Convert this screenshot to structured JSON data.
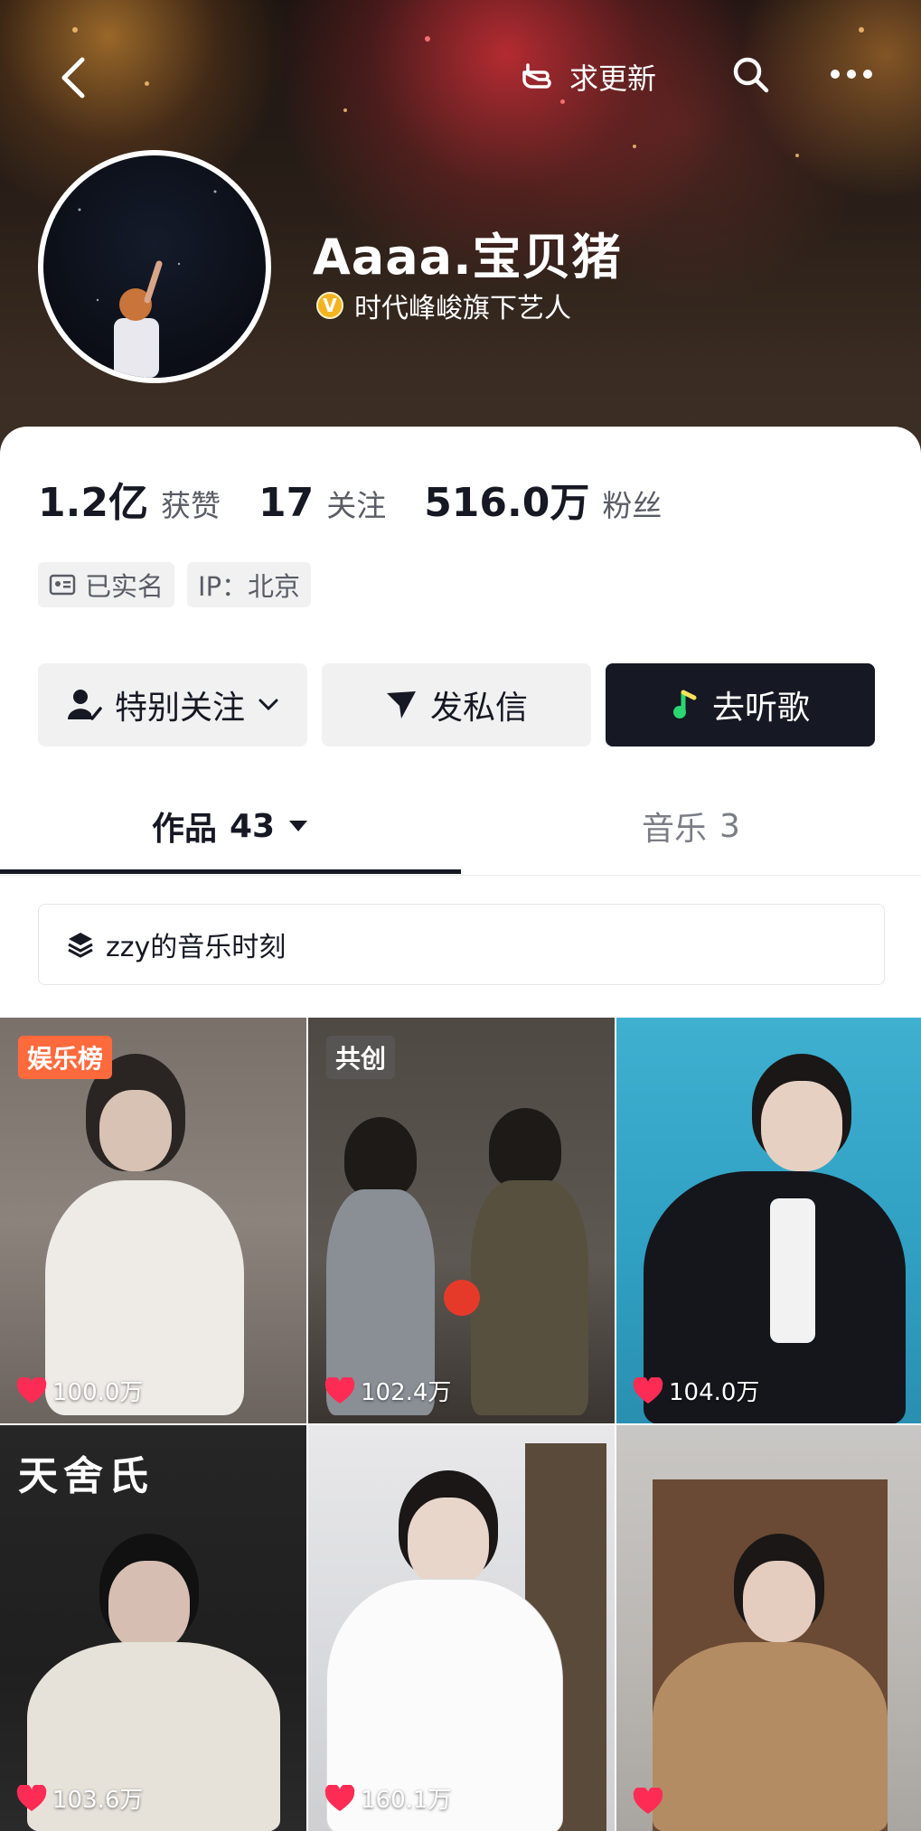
{
  "topbar": {
    "update_label": "求更新"
  },
  "profile": {
    "name": "Aaaa.宝贝猪",
    "verify_badge_letter": "V",
    "verify_text": "时代峰峻旗下艺人"
  },
  "stats": {
    "likes_value": "1.2亿",
    "likes_label": "获赞",
    "following_value": "17",
    "following_label": "关注",
    "fans_value": "516.0万",
    "fans_label": "粉丝"
  },
  "tags": {
    "realname": "已实名",
    "ip": "IP：北京"
  },
  "actions": {
    "follow": "特别关注",
    "message": "发私信",
    "listen": "去听歌"
  },
  "tabs": {
    "works_label": "作品",
    "works_count": "43",
    "music_label": "音乐",
    "music_count": "3"
  },
  "collection": {
    "label": "zzy的音乐时刻"
  },
  "videos": [
    {
      "likes": "100.0万",
      "badge": "娱乐榜"
    },
    {
      "likes": "102.4万",
      "badge": "共创"
    },
    {
      "likes": "104.0万",
      "badge": ""
    },
    {
      "likes": "103.6万",
      "badge": "",
      "art_text": "天舍氏"
    },
    {
      "likes": "160.1万",
      "badge": ""
    },
    {
      "likes": "",
      "badge": ""
    }
  ],
  "colors": {
    "primary_text": "#161823",
    "secondary_text": "#5a5c66",
    "heart": "#fe2c55",
    "listen_button": "#161823",
    "badge_orange": "#ff6a3d",
    "verify_gold": "#f4b321"
  },
  "icons": [
    "back-arrow-icon",
    "hand-pointer-icon",
    "search-icon",
    "more-dots-icon",
    "id-card-icon",
    "user-check-icon",
    "chevron-down-icon",
    "send-icon",
    "music-note-icon",
    "caret-down-icon",
    "layers-icon",
    "heart-icon"
  ]
}
